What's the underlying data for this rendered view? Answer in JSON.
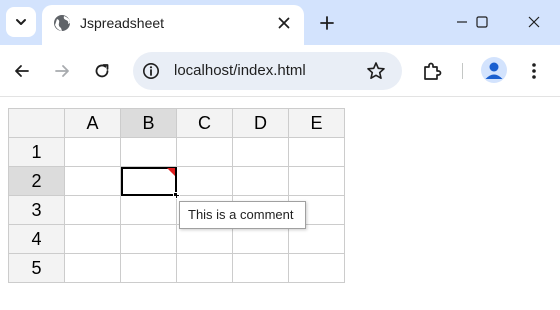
{
  "browser": {
    "tab": {
      "title": "Jspreadsheet"
    },
    "address": {
      "url": "localhost/index.html"
    }
  },
  "spreadsheet": {
    "columns": [
      "A",
      "B",
      "C",
      "D",
      "E"
    ],
    "rows": [
      "1",
      "2",
      "3",
      "4",
      "5"
    ],
    "selected_column": "B",
    "selected_row": "2"
  },
  "comment": {
    "text": "This is a comment"
  },
  "colors": {
    "tabstrip_bg": "#d3e3fd",
    "omnibox_bg": "#e9eef6",
    "header_bg": "#f3f3f3",
    "header_selected_bg": "#dcdcdc",
    "comment_flag": "#e02020",
    "profile_icon": "#1a5fcf"
  }
}
